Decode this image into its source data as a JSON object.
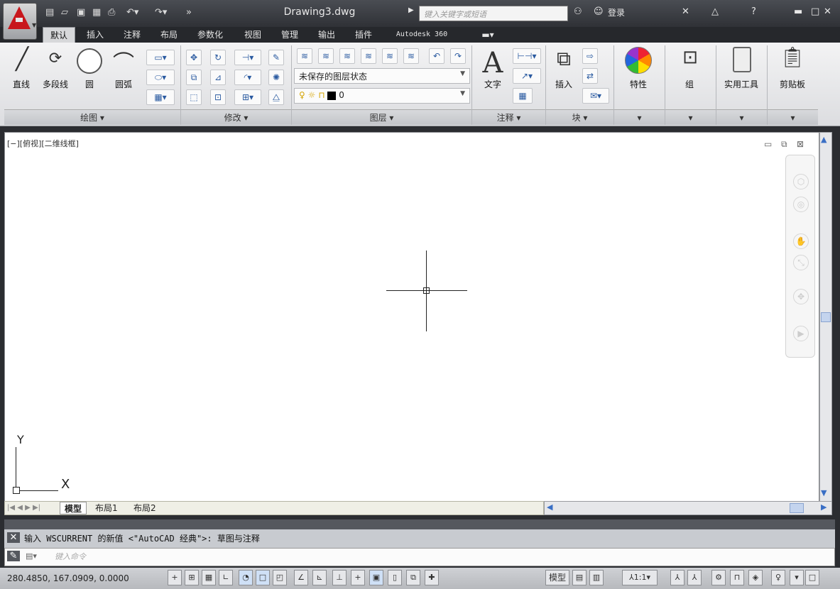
{
  "title_bar": {
    "doc_title": "Drawing3.dwg",
    "search_placeholder": "键入关键字或短语",
    "login_label": "登录",
    "qat_icons": [
      "new-icon",
      "open-icon",
      "save-icon",
      "saveas-icon",
      "print-icon",
      "undo-icon",
      "redo-icon"
    ]
  },
  "ribbon_tabs": [
    "默认",
    "插入",
    "注释",
    "布局",
    "参数化",
    "视图",
    "管理",
    "输出",
    "插件",
    "Autodesk 360"
  ],
  "ribbon": {
    "draw": {
      "title": "绘图 ▾",
      "tools": [
        "直线",
        "多段线",
        "圆",
        "圆弧"
      ]
    },
    "modify": {
      "title": "修改 ▾"
    },
    "layers": {
      "title": "图层 ▾",
      "layer_state": "未保存的图层状态",
      "layer_value": "0"
    },
    "annotation": {
      "title": "注释 ▾",
      "text": "文字"
    },
    "block": {
      "title": "块 ▾",
      "insert": "插入"
    },
    "properties": {
      "label": "特性",
      "title": "▾"
    },
    "groups": {
      "label": "组",
      "title": "▾"
    },
    "utilities": {
      "label": "实用工具",
      "title": "▾"
    },
    "clipboard": {
      "label": "剪贴板",
      "title": "▾"
    }
  },
  "viewport": {
    "label": "[−][俯视][二维线框]",
    "ucs_y": "Y",
    "ucs_x": "X"
  },
  "layout_tabs": [
    "模型",
    "布局1",
    "布局2"
  ],
  "command": {
    "history": "输入 WSCURRENT 的新值 <\"AutoCAD 经典\">: 草图与注释",
    "input_placeholder": "键入命令"
  },
  "status": {
    "coords": "280.4850, 167.0909, 0.0000",
    "model_label": "模型",
    "scale": "1:1"
  }
}
